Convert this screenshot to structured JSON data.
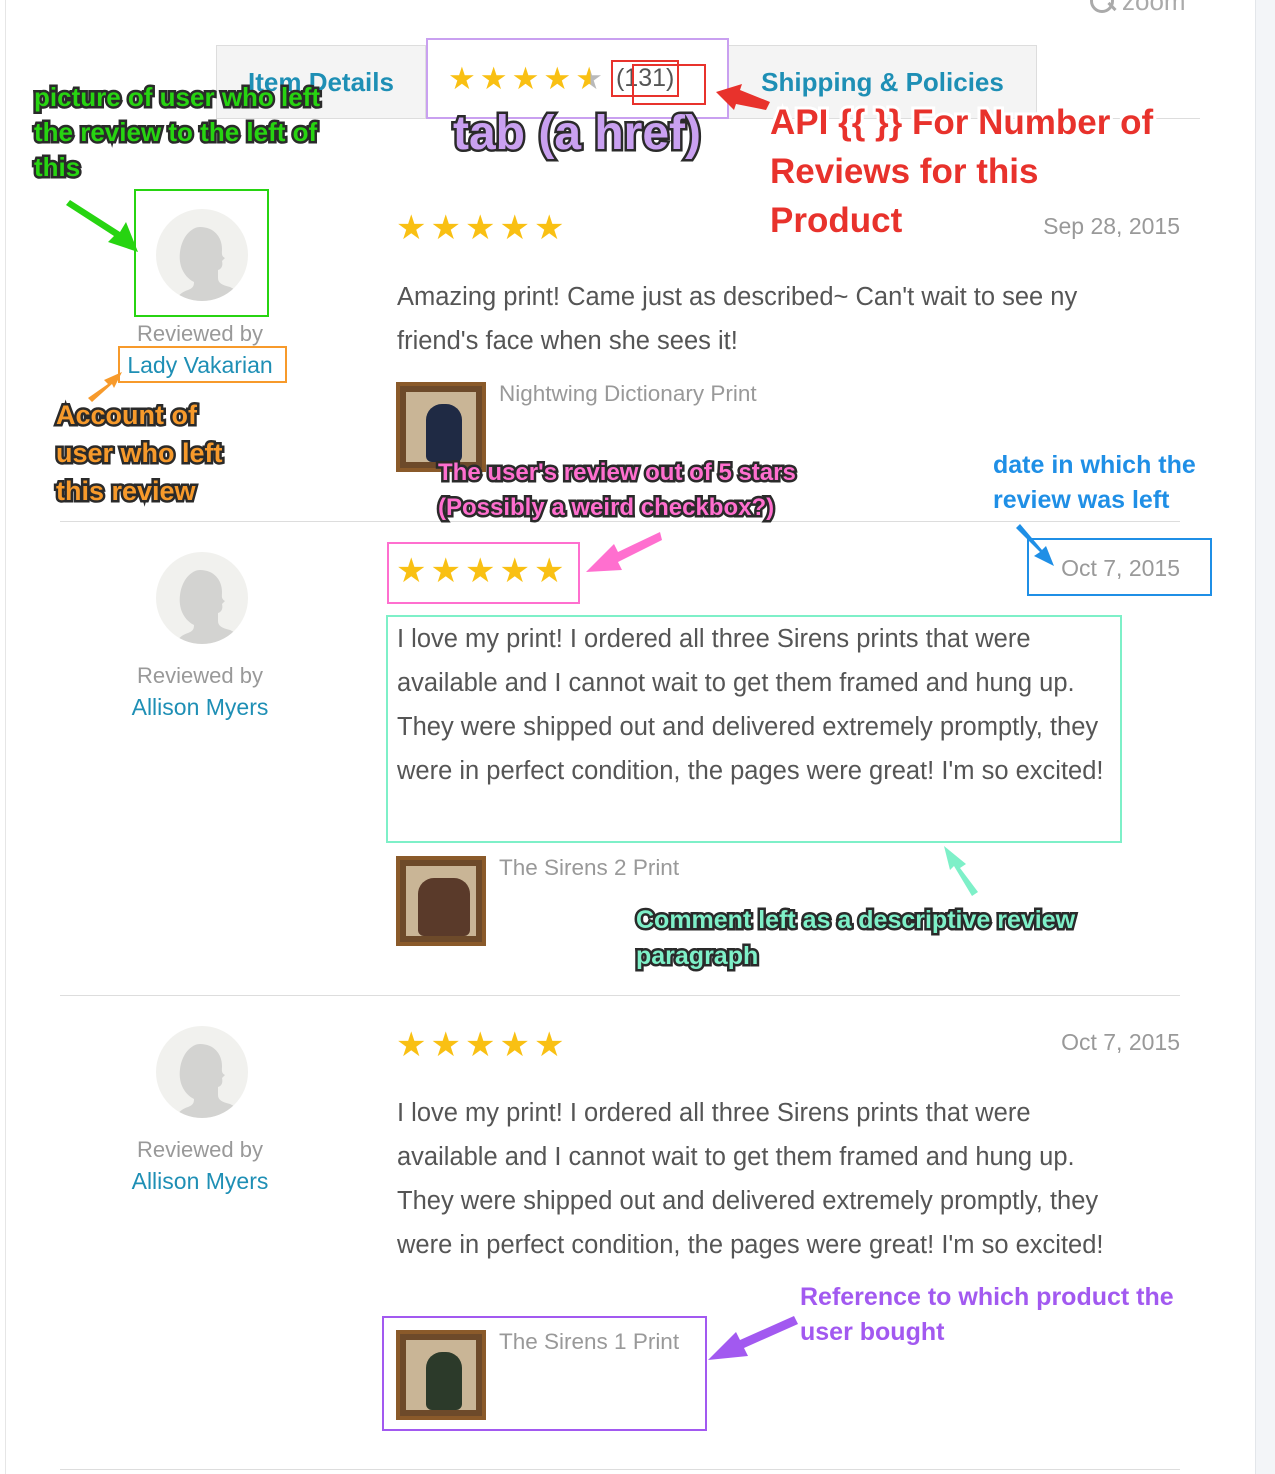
{
  "zoom_label": "zoom",
  "tabs": {
    "details": "Item Details",
    "reviews_count": "(131)",
    "shipping": "Shipping & Policies"
  },
  "reviews": [
    {
      "reviewed_by": "Reviewed by",
      "reviewer": "Lady Vakarian",
      "rating": 5,
      "date": "Sep 28, 2015",
      "text": "Amazing print! Came just as described~ Can't wait to see ny friend's face when she sees it!",
      "product": "Nightwing Dictionary Print"
    },
    {
      "reviewed_by": "Reviewed by",
      "reviewer": "Allison Myers",
      "rating": 5,
      "date": "Oct 7, 2015",
      "text": "I love my print! I ordered all three Sirens prints that were available and I cannot wait to get them framed and hung up. They were shipped out and delivered extremely promptly, they were in perfect condition, the pages were great! I'm so excited!",
      "product": "The Sirens 2 Print"
    },
    {
      "reviewed_by": "Reviewed by",
      "reviewer": "Allison Myers",
      "rating": 5,
      "date": "Oct 7, 2015",
      "text": "I love my print! I ordered all three Sirens prints that were available and I cannot wait to get them framed and hung up. They were shipped out and delivered extremely promptly, they were in perfect condition, the pages were great! I'm so excited!",
      "product": "The Sirens 1 Print"
    }
  ],
  "annotations": {
    "picture": "picture of user who left the review to the left of this",
    "tab": "tab (a href)",
    "api": "API {{ }} For Number of Reviews for this Product",
    "account": "Account of user who left this review",
    "stars": "The user's review out of 5 stars (Possibly a weird checkbox?)",
    "date": "date in which the review was left",
    "comment": "Comment left as a descriptive review paragraph",
    "reference": "Reference to which product the user bought"
  },
  "colors": {
    "link": "#1e8fb5",
    "star": "#f9c013",
    "ann_green": "#27d411",
    "ann_purple": "#c9a0f0",
    "ann_red": "#e8322c",
    "ann_orange": "#f79a2b",
    "ann_pink": "#ff6fcf",
    "ann_blue": "#1f8fe6",
    "ann_mint": "#7ef0c8",
    "ann_violet": "#a259f0"
  }
}
